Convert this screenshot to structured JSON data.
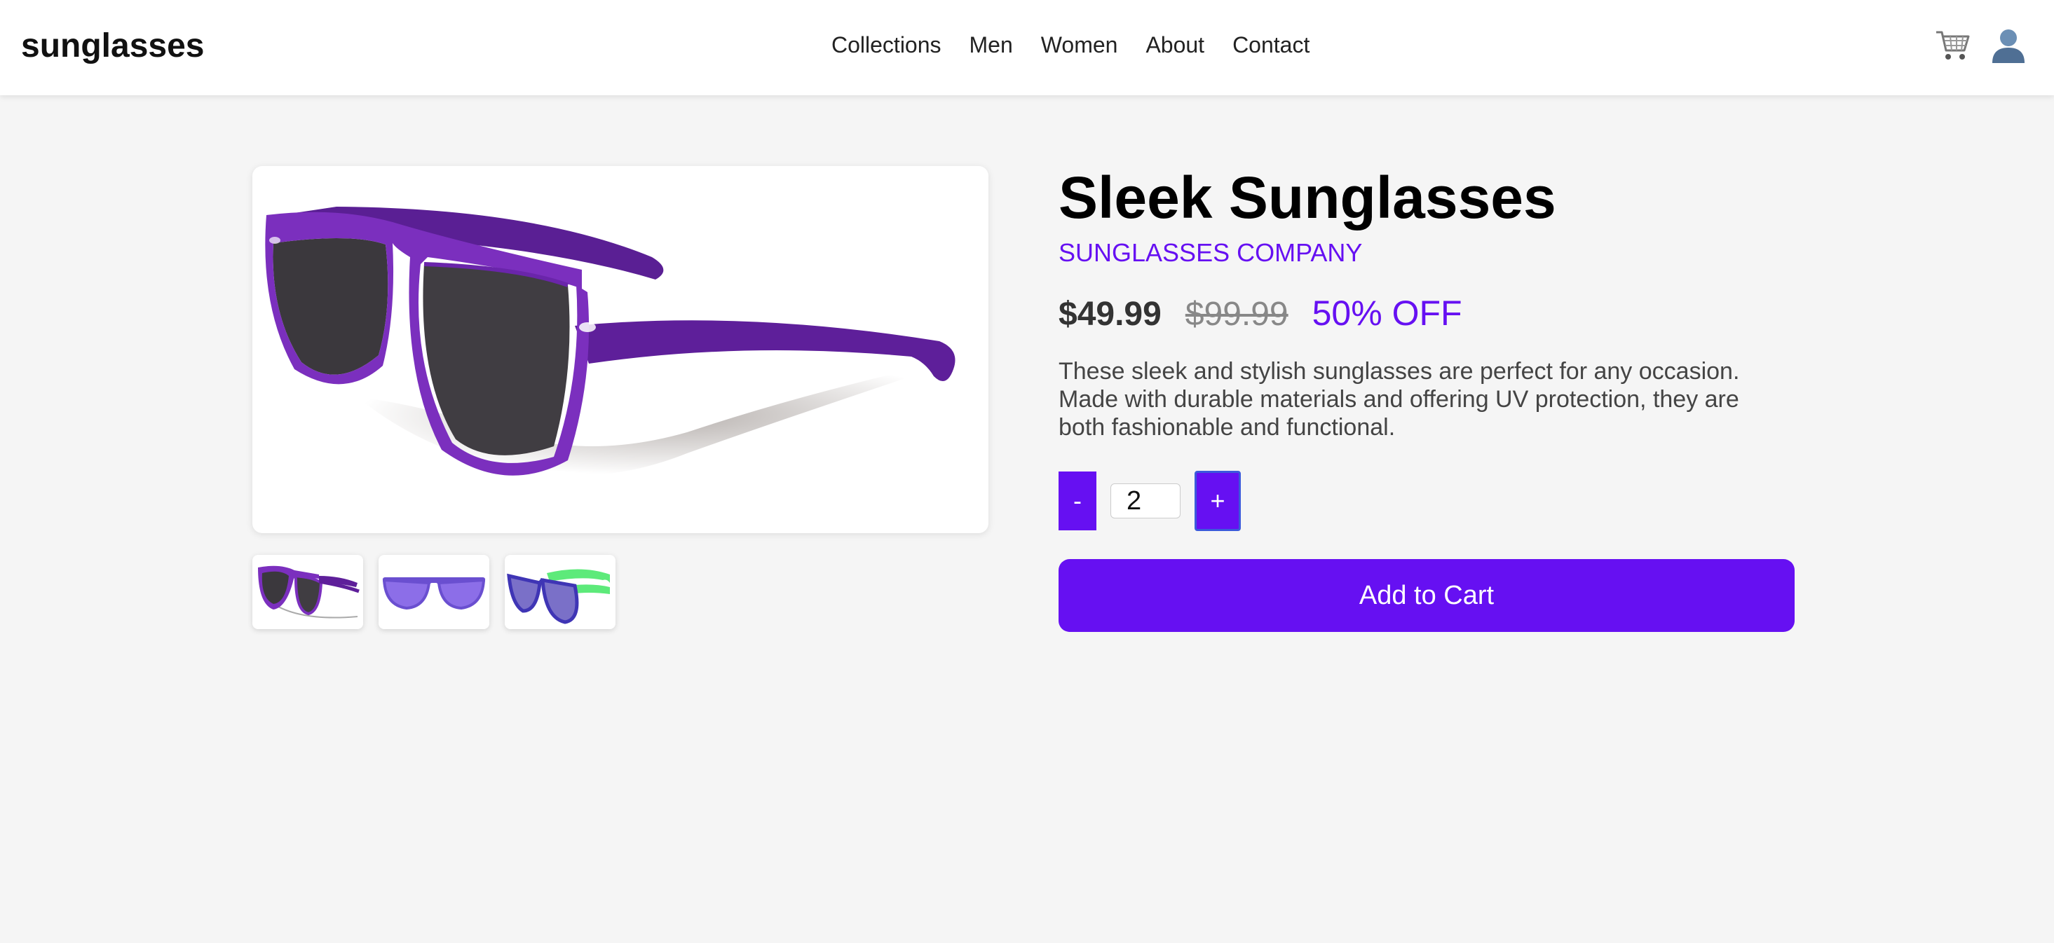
{
  "header": {
    "brand": "sunglasses",
    "nav": [
      "Collections",
      "Men",
      "Women",
      "About",
      "Contact"
    ],
    "icons": [
      "cart-icon",
      "user-icon"
    ]
  },
  "product": {
    "title": "Sleek Sunglasses",
    "company": "SUNGLASSES COMPANY",
    "price": "$49.99",
    "old_price": "$99.99",
    "discount": "50% OFF",
    "description": "These sleek and stylish sunglasses are perfect for any occasion. Made with durable materials and offering UV protection, they are both fashionable and functional.",
    "quantity": {
      "minus_label": "-",
      "value": "2",
      "plus_label": "+"
    },
    "add_to_cart_label": "Add to Cart",
    "thumbnails": [
      "purple-wayfarer",
      "lavender-wayfarer",
      "blue-green-wayfarer"
    ]
  },
  "colors": {
    "accent": "#6610f2",
    "background": "#f5f5f5",
    "frame_purple": "#7b2fbe"
  }
}
